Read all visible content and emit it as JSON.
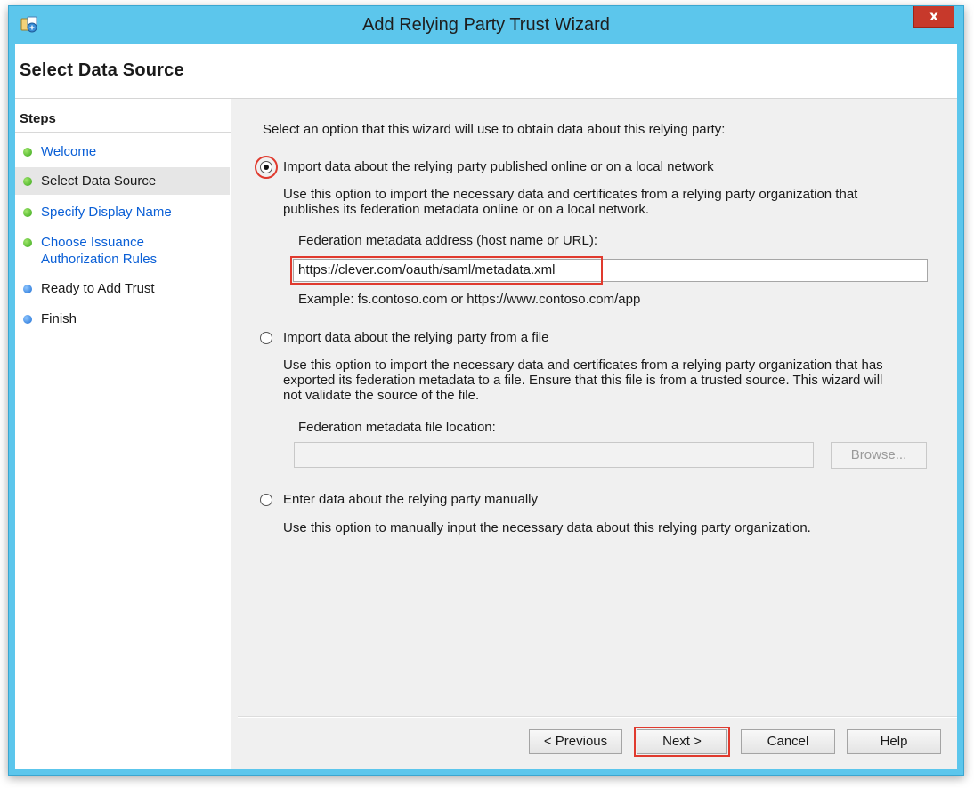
{
  "window": {
    "title": "Add Relying Party Trust Wizard",
    "close_label": "x",
    "icon": "relying-party-wizard-icon"
  },
  "page": {
    "heading": "Select Data Source"
  },
  "steps": {
    "title": "Steps",
    "items": [
      {
        "label": "Welcome",
        "state": "link",
        "dot": "green"
      },
      {
        "label": "Select Data Source",
        "state": "current",
        "dot": "green"
      },
      {
        "label": "Specify Display Name",
        "state": "link",
        "dot": "green"
      },
      {
        "label_line1": "Choose Issuance",
        "label_line2": "Authorization Rules",
        "state": "link",
        "dot": "green"
      },
      {
        "label": "Ready to Add Trust",
        "state": "normal",
        "dot": "blue"
      },
      {
        "label": "Finish",
        "state": "normal",
        "dot": "blue"
      }
    ]
  },
  "content": {
    "intro": "Select an option that this wizard will use to obtain data about this relying party:",
    "option_online": {
      "label": "Import data about the relying party published online or on a local network",
      "selected": true,
      "desc_line1": "Use this option to import the necessary data and certificates from a relying party organization that",
      "desc_line2": "publishes its federation metadata online or on a local network.",
      "field_label": "Federation metadata address (host name or URL):",
      "field_value": "https://clever.com/oauth/saml/metadata.xml",
      "example": "Example: fs.contoso.com or https://www.contoso.com/app"
    },
    "option_file": {
      "label": "Import data about the relying party from a file",
      "selected": false,
      "desc_line1": "Use this option to import the necessary data and certificates from a relying party organization that has",
      "desc_line2": "exported its federation metadata to a file. Ensure that this file is from a trusted source.  This wizard will",
      "desc_line3": "not validate the source of the file.",
      "field_label": "Federation metadata file location:",
      "field_value": "",
      "browse_label": "Browse..."
    },
    "option_manual": {
      "label": "Enter data about the relying party manually",
      "selected": false,
      "desc": "Use this option to manually input the necessary data about this relying party organization."
    }
  },
  "footer": {
    "previous_label": "< Previous",
    "next_label": "Next >",
    "cancel_label": "Cancel",
    "help_label": "Help"
  },
  "colors": {
    "window_frame": "#5cc6ec",
    "close_button": "#c7392b",
    "highlight": "#e03a2e",
    "link": "#0a5fd6",
    "step_done": "#3aa71b",
    "step_pending": "#1f6fd4"
  }
}
